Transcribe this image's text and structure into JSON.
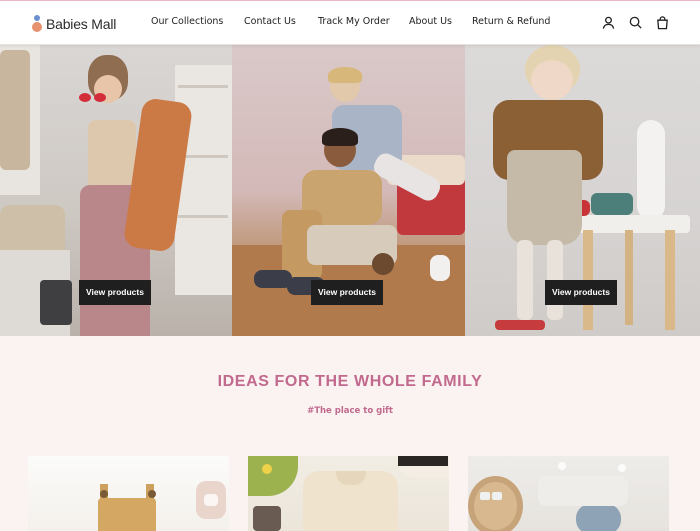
{
  "brand": {
    "name": "Babies Mall"
  },
  "nav": {
    "items": [
      {
        "label": "Our Collections"
      },
      {
        "label": "Contact Us"
      },
      {
        "label": "Track My Order"
      },
      {
        "label": "About Us"
      },
      {
        "label": "Return & Refund"
      }
    ]
  },
  "header_icons": [
    "account-icon",
    "search-icon",
    "cart-bag-icon"
  ],
  "hero": {
    "panels": [
      {
        "button_label": "View products"
      },
      {
        "button_label": "View products"
      },
      {
        "button_label": "View products"
      }
    ]
  },
  "ideas": {
    "title": "IDEAS FOR THE WHOLE FAMILY",
    "subtitle": "#The place to gift"
  },
  "colors": {
    "accent": "#c2698e",
    "button_bg": "#1f1f1f",
    "page_bg": "#faf3f1",
    "header_border": "#e7b5c6"
  }
}
